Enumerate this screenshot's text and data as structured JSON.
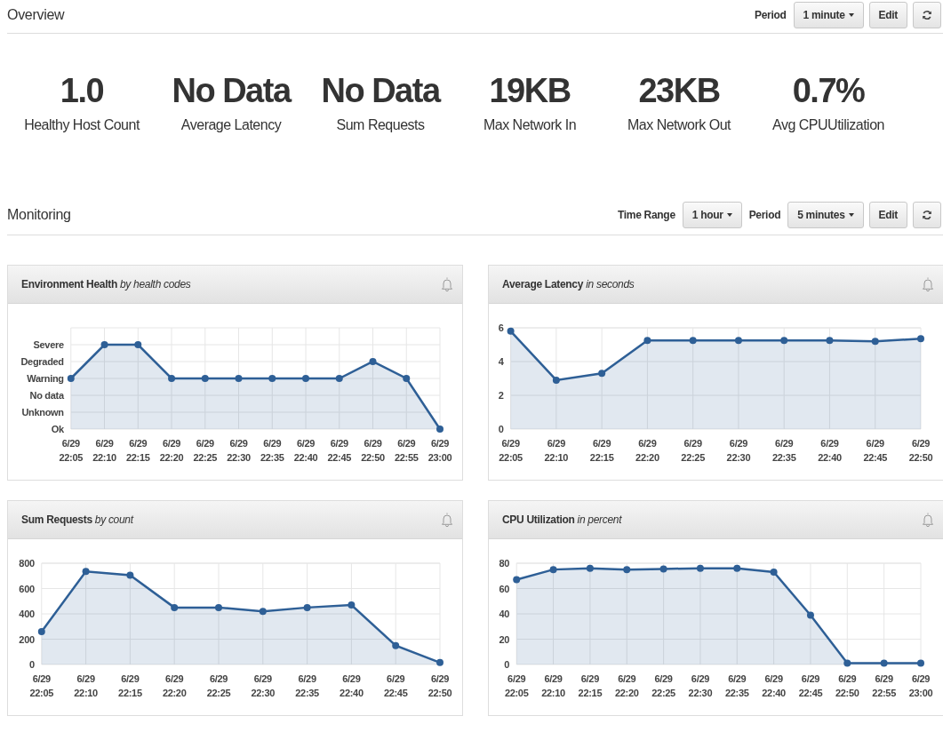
{
  "overview": {
    "title": "Overview",
    "controls": [
      {
        "kind": "label",
        "text": "Period"
      },
      {
        "kind": "dropdown",
        "text": "1 minute"
      },
      {
        "kind": "button",
        "text": "Edit"
      },
      {
        "kind": "refresh"
      }
    ],
    "metrics": [
      {
        "value": "1.0",
        "label": "Healthy Host Count"
      },
      {
        "value": "No Data",
        "label": "Average Latency"
      },
      {
        "value": "No Data",
        "label": "Sum Requests"
      },
      {
        "value": "19KB",
        "label": "Max Network In"
      },
      {
        "value": "23KB",
        "label": "Max Network Out"
      },
      {
        "value": "0.7%",
        "label": "Avg CPUUtilization"
      }
    ]
  },
  "monitoring": {
    "title": "Monitoring",
    "controls": [
      {
        "kind": "label",
        "text": "Time Range"
      },
      {
        "kind": "dropdown",
        "text": "1 hour"
      },
      {
        "kind": "label",
        "text": "Period"
      },
      {
        "kind": "dropdown",
        "text": "5 minutes"
      },
      {
        "kind": "button",
        "text": "Edit"
      },
      {
        "kind": "refresh"
      }
    ],
    "panels": [
      {
        "title": "**Environment Health** *by health codes*",
        "chart_data": {
          "type": "area",
          "categories": [
            "6/29 22:05",
            "6/29 22:10",
            "6/29 22:15",
            "6/29 22:20",
            "6/29 22:25",
            "6/29 22:30",
            "6/29 22:35",
            "6/29 22:40",
            "6/29 22:45",
            "6/29 22:50",
            "6/29 22:55",
            "6/29 23:00"
          ],
          "ylim": [
            0,
            6
          ],
          "grid": true,
          "yticks": [
            "Ok",
            "Unknown",
            "No data",
            "Warning",
            "Degraded",
            "Severe"
          ],
          "series": [
            {
              "color": "#2e5f96",
              "values": [
                3,
                5,
                5,
                3,
                3,
                3,
                3,
                3,
                3,
                4,
                3,
                0
              ]
            }
          ]
        }
      },
      {
        "title": "**Average Latency** *in seconds*",
        "chart_data": {
          "type": "area",
          "categories": [
            "6/29 22:05",
            "6/29 22:10",
            "6/29 22:15",
            "6/29 22:20",
            "6/29 22:25",
            "6/29 22:30",
            "6/29 22:35",
            "6/29 22:40",
            "6/29 22:45",
            "6/29 22:50"
          ],
          "ylim": [
            0,
            6
          ],
          "grid": true,
          "yticks": [
            0,
            2,
            4,
            6
          ],
          "series": [
            {
              "color": "#2e5f96",
              "values": [
                5.8,
                2.9,
                3.3,
                5.25,
                5.25,
                5.25,
                5.25,
                5.25,
                5.2,
                5.35
              ]
            }
          ]
        }
      },
      {
        "title": "**Sum Requests** *by count*",
        "chart_data": {
          "type": "area",
          "categories": [
            "6/29 22:05",
            "6/29 22:10",
            "6/29 22:15",
            "6/29 22:20",
            "6/29 22:25",
            "6/29 22:30",
            "6/29 22:35",
            "6/29 22:40",
            "6/29 22:45",
            "6/29 22:50"
          ],
          "ylim": [
            0,
            800
          ],
          "grid": true,
          "yticks": [
            0,
            200,
            400,
            600,
            800
          ],
          "series": [
            {
              "color": "#2e5f96",
              "values": [
                260,
                735,
                705,
                450,
                450,
                420,
                450,
                470,
                150,
                15
              ]
            }
          ]
        }
      },
      {
        "title": "**CPU Utilization** *in percent*",
        "chart_data": {
          "type": "area",
          "categories": [
            "6/29 22:05",
            "6/29 22:10",
            "6/29 22:15",
            "6/29 22:20",
            "6/29 22:25",
            "6/29 22:30",
            "6/29 22:35",
            "6/29 22:40",
            "6/29 22:45",
            "6/29 22:50",
            "6/29 22:55",
            "6/29 23:00"
          ],
          "ylim": [
            0,
            80
          ],
          "grid": true,
          "yticks": [
            0,
            20,
            40,
            60,
            80
          ],
          "series": [
            {
              "color": "#2e5f96",
              "values": [
                67,
                75,
                76,
                75,
                75.5,
                76,
                76,
                73,
                39,
                1,
                1,
                1
              ]
            }
          ]
        }
      }
    ]
  }
}
